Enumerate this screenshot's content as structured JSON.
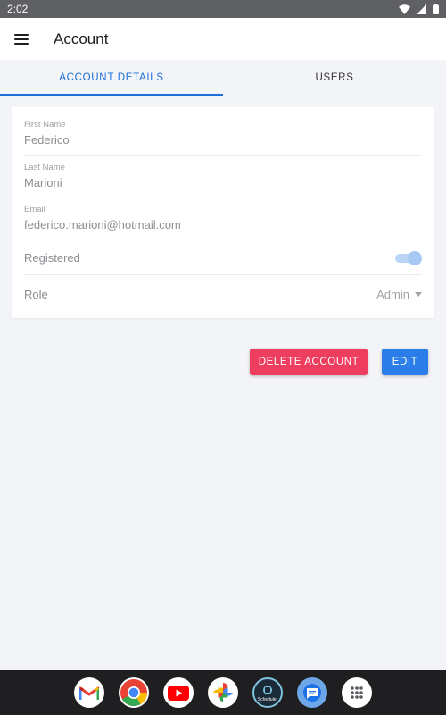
{
  "status_bar": {
    "time": "2:02"
  },
  "app_bar": {
    "title": "Account"
  },
  "tabs": [
    {
      "label": "ACCOUNT DETAILS",
      "active": true
    },
    {
      "label": "USERS",
      "active": false
    }
  ],
  "form": {
    "first_name": {
      "label": "First Name",
      "value": "Federico"
    },
    "last_name": {
      "label": "Last Name",
      "value": "Marioni"
    },
    "email": {
      "label": "Email",
      "value": "federico.marioni@hotmail.com"
    },
    "registered": {
      "label": "Registered",
      "checked": true
    },
    "role": {
      "label": "Role",
      "value": "Admin"
    }
  },
  "actions": {
    "delete_label": "DELETE ACCOUNT",
    "edit_label": "EDIT"
  },
  "dock": {
    "apps": [
      "gmail-icon",
      "chrome-icon",
      "youtube-icon",
      "photos-icon",
      "scheduler-icon",
      "messages-icon",
      "app-drawer-icon"
    ],
    "scheduler_caption": "Scheduler"
  },
  "colors": {
    "accent": "#1e6fd9",
    "delete": "#ee3e5f",
    "edit": "#2b7de9",
    "background": "#f3f4f8"
  }
}
